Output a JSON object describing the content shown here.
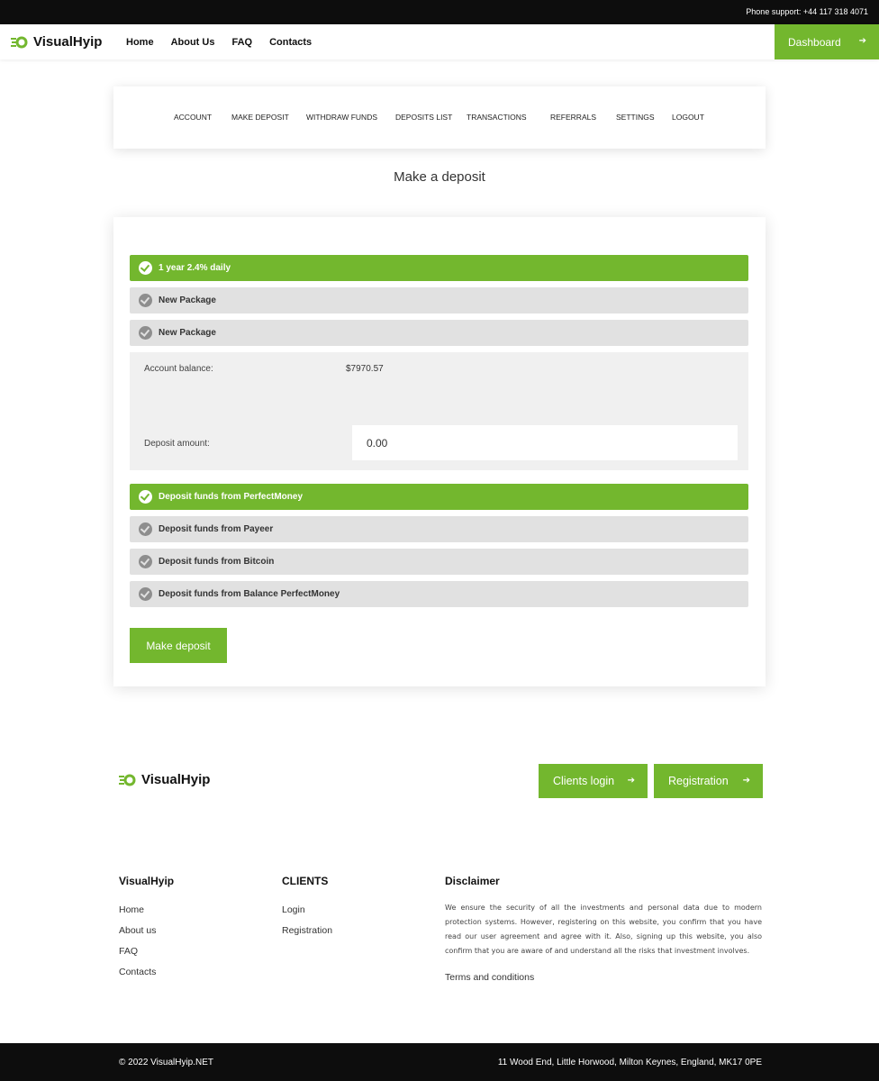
{
  "topbar": {
    "phone": "Phone support: +44 117 318 4071"
  },
  "header": {
    "logo_text": "VisualHyip",
    "nav": [
      "Home",
      "About Us",
      "FAQ",
      "Contacts"
    ],
    "dashboard_label": "Dashboard"
  },
  "account_menu": [
    "ACCOUNT",
    "MAKE DEPOSIT",
    "WITHDRAW FUNDS",
    "DEPOSITS LIST",
    "TRANSACTIONS",
    "REFERRALS",
    "SETTINGS",
    "LOGOUT"
  ],
  "page_title": "Make a deposit",
  "plans": [
    {
      "label": "1 year 2.4% daily",
      "selected": true
    },
    {
      "label": "New Package",
      "selected": false
    },
    {
      "label": "New Package",
      "selected": false
    }
  ],
  "details": {
    "balance_label": "Account balance:",
    "balance_value": "$7970.57",
    "amount_label": "Deposit amount:",
    "amount_value": "0.00"
  },
  "payment_methods": [
    {
      "label": "Deposit funds from PerfectMoney",
      "selected": true
    },
    {
      "label": "Deposit funds from Payeer",
      "selected": false
    },
    {
      "label": "Deposit funds from Bitcoin",
      "selected": false
    },
    {
      "label": "Deposit funds from Balance PerfectMoney",
      "selected": false
    }
  ],
  "make_deposit_label": "Make deposit",
  "footer": {
    "logo_text": "VisualHyip",
    "clients_login_label": "Clients login",
    "registration_label": "Registration",
    "col1": {
      "title": "VisualHyip",
      "links": [
        "Home",
        "About us",
        "FAQ",
        "Contacts"
      ]
    },
    "col2": {
      "title": "CLIENTS",
      "links": [
        "Login",
        "Registration"
      ]
    },
    "col3": {
      "title": "Disclaimer",
      "text": "We ensure the security of all the investments and personal data due to modern protection systems. However, registering on this website, you confirm that you have read our user agreement and agree with it. Also, signing up this website, you also confirm that you are aware of and understand all the risks that investment involves.",
      "terms_label": "Terms and conditions"
    },
    "copyright": "© 2022 VisualHyip.NET",
    "address": "11 Wood End, Little Horwood, Milton Keynes, England, MK17 0PE"
  },
  "colors": {
    "accent": "#73b72e",
    "dark": "#0d0d0d",
    "option_bg": "#e1e1e1"
  },
  "icons": {
    "logo": "coin-stack-icon",
    "check": "check-circle-icon",
    "arrow": "arrow-right-icon"
  }
}
